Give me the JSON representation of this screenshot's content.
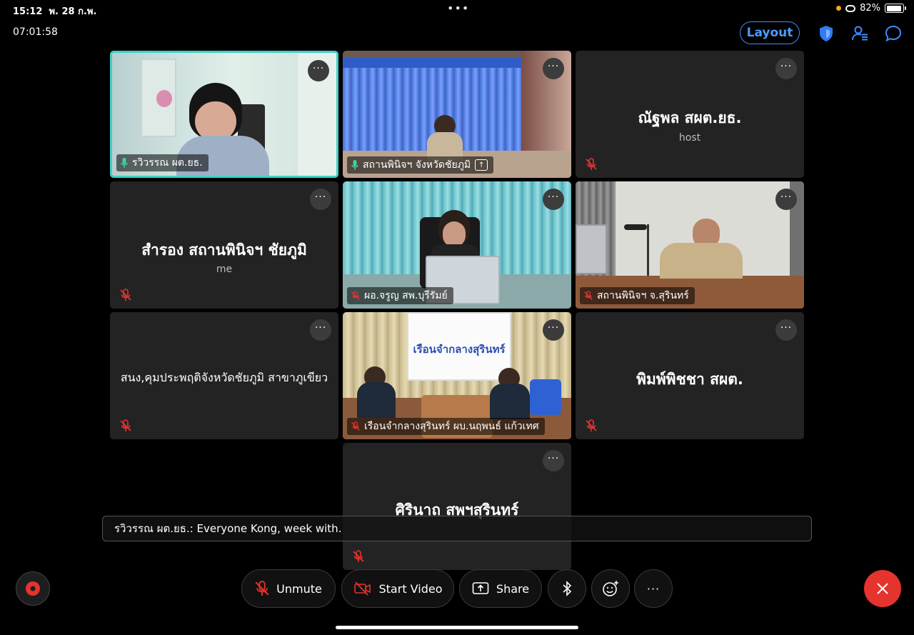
{
  "status_bar": {
    "time": "15:12",
    "date": "พ. 28 ก.พ.",
    "dots": "•••",
    "battery": "82%",
    "battery_level": 0.82
  },
  "meeting": {
    "elapsed": "07:01:58",
    "layout_label": "Layout"
  },
  "tiles": [
    {
      "name": "รวิวรรณ ผต.ยธ.",
      "type": "video",
      "mic": "on",
      "active": true
    },
    {
      "name": "สถานพินิจฯ จังหวัดชัยภูมิ",
      "type": "video",
      "mic": "on",
      "sharing": true
    },
    {
      "name": "ณัฐพล สผต.ยธ.",
      "sub": "host",
      "type": "avatar",
      "mic": "off"
    },
    {
      "name": "สำรอง สถานพินิจฯ ชัยภูมิ",
      "sub": "me",
      "type": "avatar",
      "mic": "off"
    },
    {
      "name": "ผอ.จรูญ สพ.บุรีรัมย์",
      "type": "video",
      "mic": "off"
    },
    {
      "name": "สถานพินิจฯ จ.สุรินทร์",
      "type": "video",
      "mic": "off"
    },
    {
      "name": "สนง,คุมประพฤติจังหวัดชัยภูมิ สาขาภูเขียว",
      "type": "avatar",
      "mic": "off"
    },
    {
      "name": "เรือนจำกลางสุรินทร์ ผบ.นฤพนธ์ แก้วเทศ",
      "type": "video",
      "mic": "off",
      "banner": "เรือนจำกลางสุรินทร์"
    },
    {
      "name": "พิมพ์พิชชา สผต.",
      "type": "avatar",
      "mic": "off"
    },
    {
      "name": "ศิรินาถ สพฯสุรินทร์",
      "type": "avatar",
      "mic": "off"
    }
  ],
  "caption": {
    "speaker": "รวิวรรณ ผต.ยธ.:",
    "text": "Everyone Kong, week with."
  },
  "toolbar": {
    "unmute": "Unmute",
    "start_video": "Start Video",
    "share": "Share",
    "more": "···"
  },
  "icons": {
    "record": "record-icon",
    "leave": "close-icon",
    "shield": "shield-icon",
    "participants": "participants-icon",
    "chat": "chat-icon"
  },
  "colors": {
    "accent": "#3d8bff",
    "active_speaker": "#3fd1c4",
    "muted": "#e5332e",
    "leave": "#e5332e"
  }
}
